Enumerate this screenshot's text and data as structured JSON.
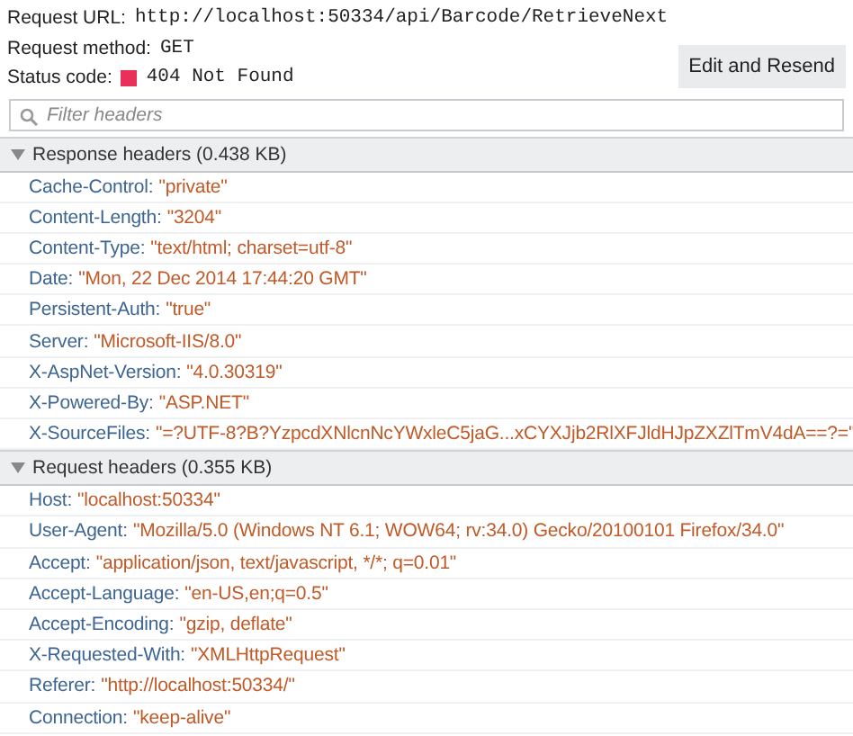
{
  "summary": [
    {
      "label": "Request URL:",
      "value": "http://localhost:50334/api/Barcode/RetrieveNext"
    },
    {
      "label": "Request method:",
      "value": "GET"
    },
    {
      "label": "Status code:",
      "value": "404 Not Found",
      "color": "#e8305a"
    }
  ],
  "edit_button": "Edit and Resend",
  "filter": {
    "placeholder": "Filter headers"
  },
  "sections": [
    {
      "title": "Response headers (0.438 KB)",
      "expanded": true,
      "headers": [
        {
          "name": "Cache-Control:",
          "value": "\"private\""
        },
        {
          "name": "Content-Length:",
          "value": "\"3204\""
        },
        {
          "name": "Content-Type:",
          "value": "\"text/html; charset=utf-8\""
        },
        {
          "name": "Date:",
          "value": "\"Mon, 22 Dec 2014 17:44:20 GMT\""
        },
        {
          "name": "Persistent-Auth:",
          "value": "\"true\""
        },
        {
          "name": "Server:",
          "value": "\"Microsoft-IIS/8.0\""
        },
        {
          "name": "X-AspNet-Version:",
          "value": "\"4.0.30319\""
        },
        {
          "name": "X-Powered-By:",
          "value": "\"ASP.NET\""
        },
        {
          "name": "X-SourceFiles:",
          "value": "\"=?UTF-8?B?YzpcdXNlcnNcYWxleC5jaG...xCYXJjb2RlXFJldHJpZXZlTmV4dA==?=\""
        }
      ]
    },
    {
      "title": "Request headers (0.355 KB)",
      "expanded": true,
      "headers": [
        {
          "name": "Host:",
          "value": "\"localhost:50334\""
        },
        {
          "name": "User-Agent:",
          "value": "\"Mozilla/5.0 (Windows NT 6.1; WOW64; rv:34.0) Gecko/20100101 Firefox/34.0\""
        },
        {
          "name": "Accept:",
          "value": "\"application/json, text/javascript, */*; q=0.01\""
        },
        {
          "name": "Accept-Language:",
          "value": "\"en-US,en;q=0.5\""
        },
        {
          "name": "Accept-Encoding:",
          "value": "\"gzip, deflate\""
        },
        {
          "name": "X-Requested-With:",
          "value": "\"XMLHttpRequest\""
        },
        {
          "name": "Referer:",
          "value": "\"http://localhost:50334/\""
        },
        {
          "name": "Connection:",
          "value": "\"keep-alive\""
        }
      ]
    }
  ]
}
